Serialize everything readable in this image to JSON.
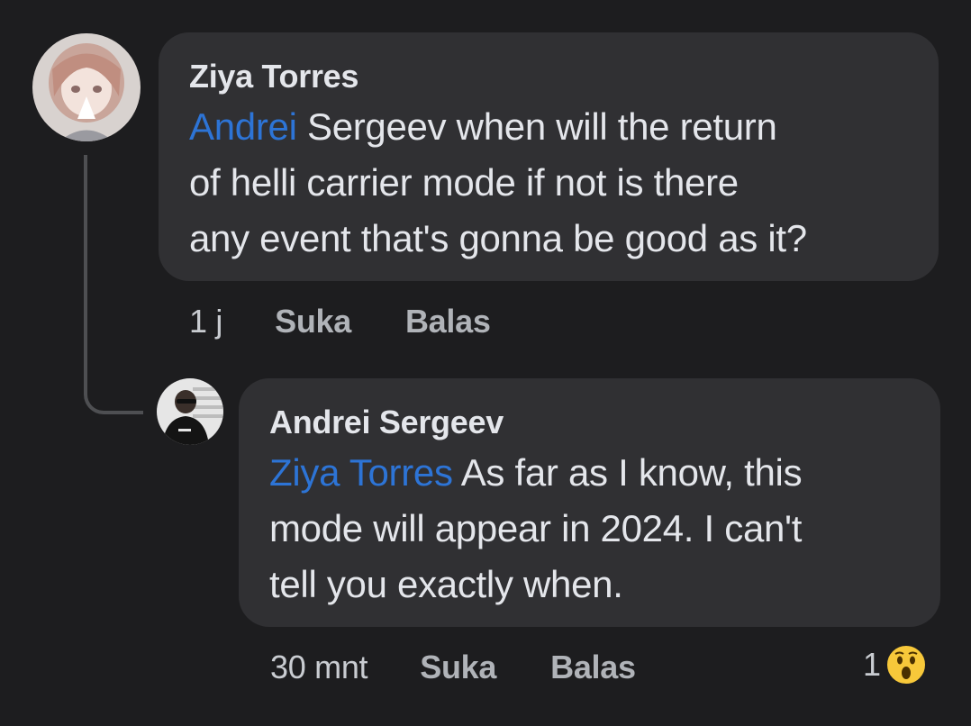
{
  "comment": {
    "author": "Ziya Torres",
    "mention": "Andrei",
    "text_lines": [
      " Sergeev when will the return",
      "of helli carrier mode if not is there",
      "any event that's gonna be good as it?"
    ],
    "time": "1 j",
    "like_label": "Suka",
    "reply_label": "Balas"
  },
  "reply": {
    "author": "Andrei Sergeev",
    "mention": "Ziya Torres",
    "text_lines": [
      " As far as I know, this",
      "mode will appear in 2024. I can't",
      "tell you exactly when."
    ],
    "time": "30 mnt",
    "like_label": "Suka",
    "reply_label": "Balas",
    "reaction_count": "1",
    "reaction_icon": "wow-emoji-icon"
  },
  "colors": {
    "background": "#1d1d1f",
    "bubble": "#303033",
    "mention": "#2d74d6",
    "thread_line": "#4e4f52"
  }
}
